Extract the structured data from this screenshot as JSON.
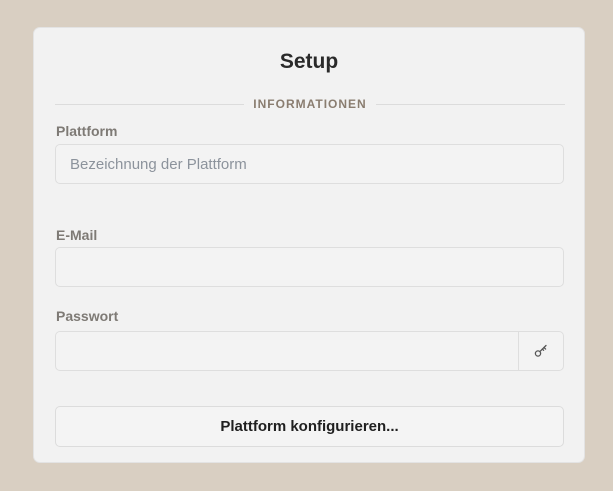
{
  "card": {
    "title": "Setup",
    "section_label": "INFORMATIONEN"
  },
  "fields": {
    "platform": {
      "label": "Plattform",
      "placeholder": "Bezeichnung der Plattform",
      "value": ""
    },
    "email": {
      "label": "E-Mail",
      "placeholder": "",
      "value": ""
    },
    "password": {
      "label": "Passwort",
      "placeholder": "",
      "value": "",
      "toggle_icon": "key-icon"
    }
  },
  "actions": {
    "configure_label": "Plattform konfigurieren..."
  },
  "colors": {
    "page_background": "#d9cfc2",
    "card_background": "#f2f2f2",
    "section_label": "#8a7d70",
    "field_label": "#7e7a75"
  }
}
